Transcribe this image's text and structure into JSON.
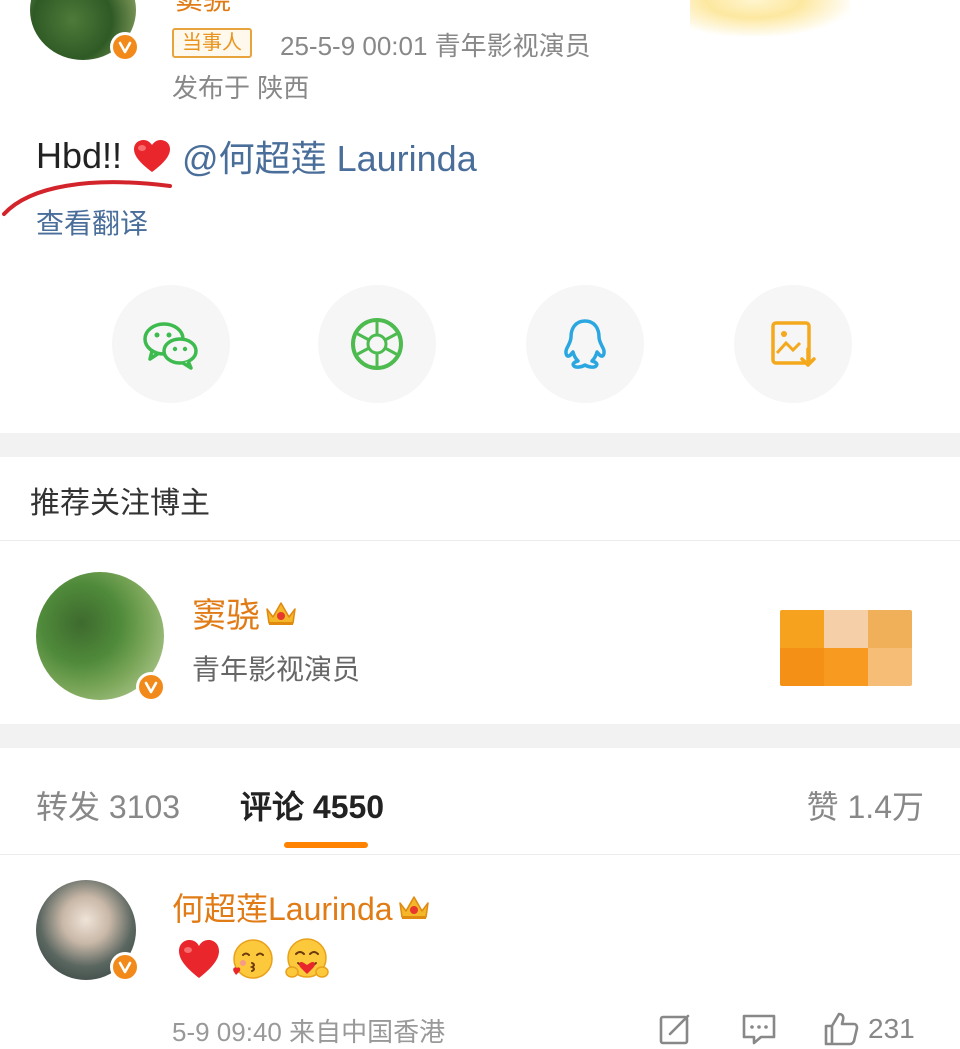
{
  "post": {
    "author_partial": "窦骁",
    "tag": "当事人",
    "meta": "25-5-9 00:01  青年影视演员",
    "location": "发布于 陕西",
    "text_prefix": "Hbd!!",
    "mention": "@何超莲 Laurinda",
    "translate": "查看翻译"
  },
  "share": {
    "items": [
      {
        "icon": "wechat-icon",
        "color": "#3dbb4f"
      },
      {
        "icon": "moments-icon",
        "color": "#4dbb4f"
      },
      {
        "icon": "qq-icon",
        "color": "#2aa6e0"
      },
      {
        "icon": "save-image-icon",
        "color": "#f4a81c"
      }
    ]
  },
  "recommend": {
    "title": "推荐关注博主",
    "name": "窦骁",
    "desc": "青年影视演员"
  },
  "tabs": {
    "repost": "转发 3103",
    "comments": "评论 4550",
    "likes": "赞 1.4万"
  },
  "comment": {
    "name": "何超莲Laurinda",
    "emojis": [
      "heart-emoji",
      "kiss-emoji",
      "hug-emoji"
    ],
    "footer": "5-9 09:40  来自中国香港",
    "like_count": "231"
  },
  "colors": {
    "accent": "#ff8200",
    "name_orange": "#e07b16",
    "link_blue": "#4a6e9a",
    "verified": "#f28a1b"
  }
}
